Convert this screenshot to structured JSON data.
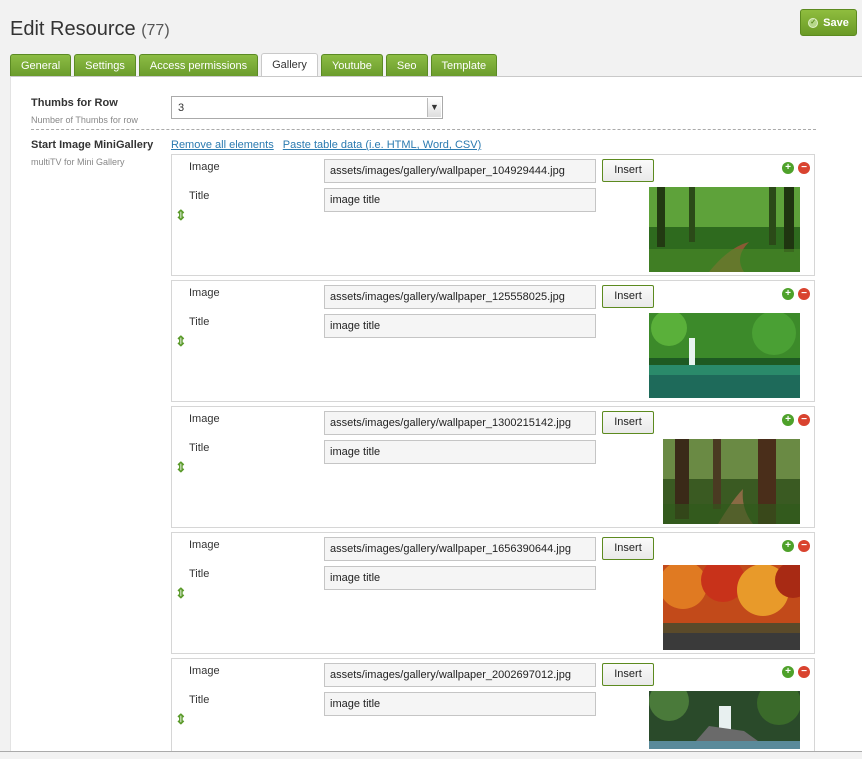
{
  "header": {
    "title": "Edit Resource",
    "count": "(77)",
    "save_label": "Save"
  },
  "tabs": [
    {
      "label": "General"
    },
    {
      "label": "Settings"
    },
    {
      "label": "Access permissions"
    },
    {
      "label": "Gallery",
      "active": true
    },
    {
      "label": "Youtube"
    },
    {
      "label": "Seo"
    },
    {
      "label": "Template"
    }
  ],
  "thumbs_field": {
    "label": "Thumbs for Row",
    "description": "Number of Thumbs for row",
    "value": "3"
  },
  "gallery_field": {
    "label": "Start Image MiniGallery",
    "description": "multiTV for Mini Gallery",
    "remove_all": "Remove all elements",
    "paste_table": "Paste table data (i.e. HTML, Word, CSV)"
  },
  "row_labels": {
    "image": "Image",
    "title": "Title",
    "insert": "Insert"
  },
  "items": [
    {
      "image": "assets/images/gallery/wallpaper_104929444.jpg",
      "title": "image title",
      "thumb": "forest-path"
    },
    {
      "image": "assets/images/gallery/wallpaper_125558025.jpg",
      "title": "image title",
      "thumb": "waterfall-green"
    },
    {
      "image": "assets/images/gallery/wallpaper_1300215142.jpg",
      "title": "image title",
      "thumb": "forest-trees"
    },
    {
      "image": "assets/images/gallery/wallpaper_1656390644.jpg",
      "title": "image title",
      "thumb": "autumn-trees"
    },
    {
      "image": "assets/images/gallery/wallpaper_2002697012.jpg",
      "title": "image title",
      "thumb": "waterfall-rocks"
    }
  ],
  "colors": {
    "accent_green": "#7aab33",
    "link": "#2a7ab0",
    "delete_red": "#d9432f"
  }
}
